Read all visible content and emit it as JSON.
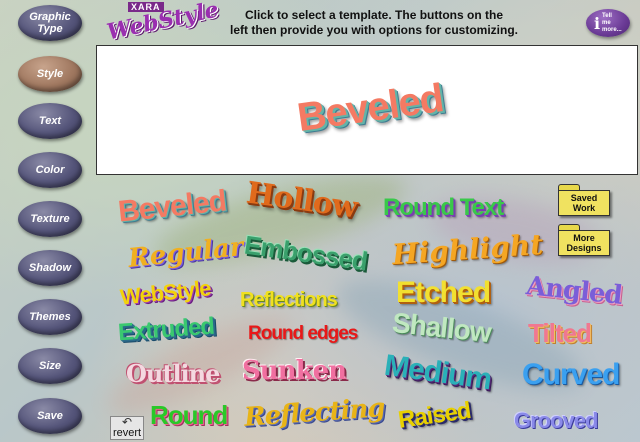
{
  "header": {
    "logo_prefix": "XARA",
    "logo_name": "WebStyle",
    "instructions_line1": "Click to select a template. The buttons on the",
    "instructions_line2": "left then provide you with options for customizing.",
    "tellme_label": "Tell me more..."
  },
  "sidebar": {
    "items": [
      {
        "label": "Graphic Type",
        "active": false
      },
      {
        "label": "Style",
        "active": true
      },
      {
        "label": "Text",
        "active": false
      },
      {
        "label": "Color",
        "active": false
      },
      {
        "label": "Texture",
        "active": false
      },
      {
        "label": "Shadow",
        "active": false
      },
      {
        "label": "Themes",
        "active": false
      },
      {
        "label": "Size",
        "active": false
      },
      {
        "label": "Save",
        "active": false
      }
    ]
  },
  "preview": {
    "text": "Beveled"
  },
  "folders": {
    "saved_work": "Saved Work",
    "more_designs": "More Designs"
  },
  "templates": {
    "beveled": "Beveled",
    "hollow": "Hollow",
    "round_text": "Round Text",
    "regular": "Regular",
    "embossed": "Embossed",
    "highlight": "Highlight",
    "webstyle": "WebStyle",
    "reflections": "Reflections",
    "etched": "Etched",
    "angled": "Angled",
    "extruded": "Extruded",
    "round_edges": "Round edges",
    "shallow": "Shallow",
    "tilted": "Tilted",
    "outline": "Outline",
    "sunken": "Sunken",
    "medium": "Medium",
    "curved": "Curved",
    "round": "Round",
    "reflecting": "Reflecting",
    "raised": "Raised",
    "grooved": "Grooved"
  },
  "revert_label": "revert",
  "colors": {
    "sidebar_button": "#55557a",
    "sidebar_button_active": "#a07860",
    "folder": "#f0e260"
  }
}
